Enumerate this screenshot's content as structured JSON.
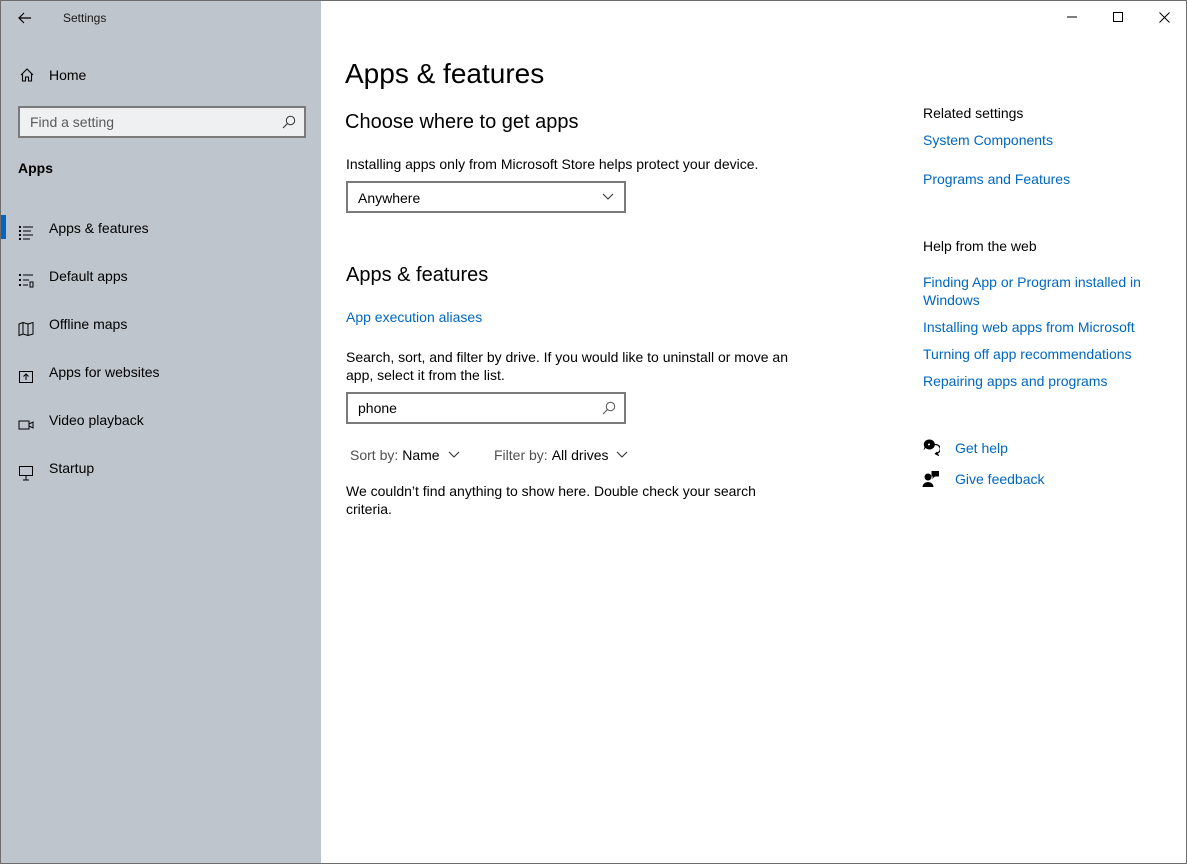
{
  "window": {
    "app_title": "Settings",
    "controls": [
      "minimize-icon",
      "maximize-icon",
      "close-icon"
    ]
  },
  "sidebar": {
    "home_label": "Home",
    "search_placeholder": "Find a setting",
    "section_label": "Apps",
    "items": [
      {
        "label": "Apps & features",
        "icon": "list-icon",
        "active": true
      },
      {
        "label": "Default apps",
        "icon": "default-list-icon",
        "active": false
      },
      {
        "label": "Offline maps",
        "icon": "map-icon",
        "active": false
      },
      {
        "label": "Apps for websites",
        "icon": "open-external-icon",
        "active": false
      },
      {
        "label": "Video playback",
        "icon": "video-icon",
        "active": false
      },
      {
        "label": "Startup",
        "icon": "startup-icon",
        "active": false
      }
    ]
  },
  "main": {
    "title": "Apps & features",
    "choose_heading": "Choose where to get apps",
    "choose_desc": "Installing apps only from Microsoft Store helps protect your device.",
    "source_dropdown_value": "Anywhere",
    "apps_heading": "Apps & features",
    "aliases_link": "App execution aliases",
    "search_desc": "Search, sort, and filter by drive. If you would like to uninstall or move an app, select it from the list.",
    "search_value": "phone",
    "sort_key": "Sort by:",
    "sort_value": "Name",
    "filter_key": "Filter by:",
    "filter_value": "All drives",
    "empty_message": "We couldn’t find anything to show here. Double check your search criteria."
  },
  "related": {
    "related_heading": "Related settings",
    "related_links": [
      "System Components",
      "Programs and Features"
    ],
    "help_heading": "Help from the web",
    "help_links": [
      "Finding App or Program installed in Windows",
      "Installing web apps from Microsoft",
      "Turning off app recommendations",
      "Repairing apps and programs"
    ],
    "get_help": "Get help",
    "give_feedback": "Give feedback"
  },
  "colors": {
    "sidebar_bg": "#bec5cc",
    "accent": "#0067c0"
  }
}
